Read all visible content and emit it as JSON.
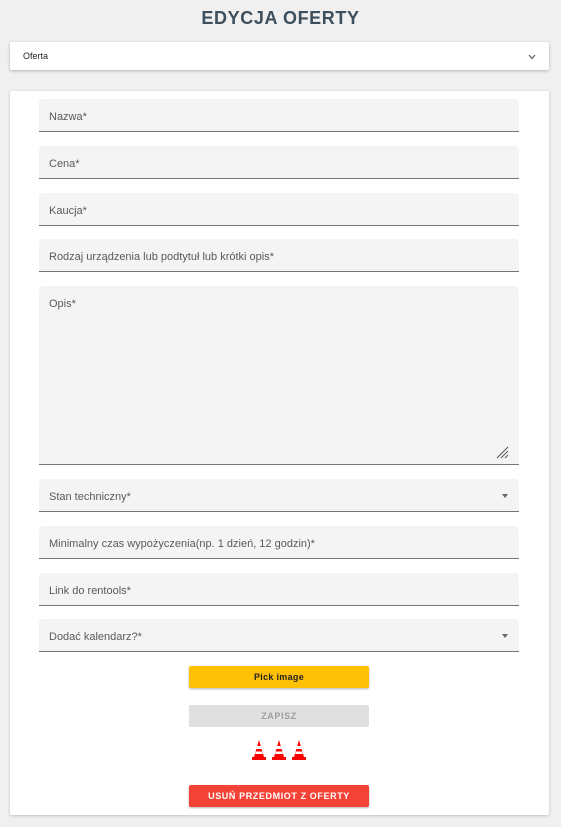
{
  "header": {
    "title": "EDYCJA OFERTY"
  },
  "accordion": {
    "label": "Oferta",
    "icon": "chevron-down-icon"
  },
  "form": {
    "nazwa": "Nazwa*",
    "cena": "Cena*",
    "kaucja": "Kaucja*",
    "rodzaj": "Rodzaj urządzenia lub podtytuł lub krótki opis*",
    "opis": "Opis*",
    "stan": "Stan techniczny*",
    "min_czas": "Minimalny czas wypożyczenia(np. 1 dzień, 12 godzin)*",
    "link": "Link do rentools*",
    "kalendarz": "Dodać kalendarz?*"
  },
  "buttons": {
    "pick_image": "Pick image",
    "save": "ZAPISZ",
    "delete": "USUŃ PRZEDMIOT Z OFERTY"
  },
  "colors": {
    "accent": "#ffc107",
    "danger": "#f44336",
    "title": "#3d4f5c",
    "cone": "#ff0000"
  }
}
